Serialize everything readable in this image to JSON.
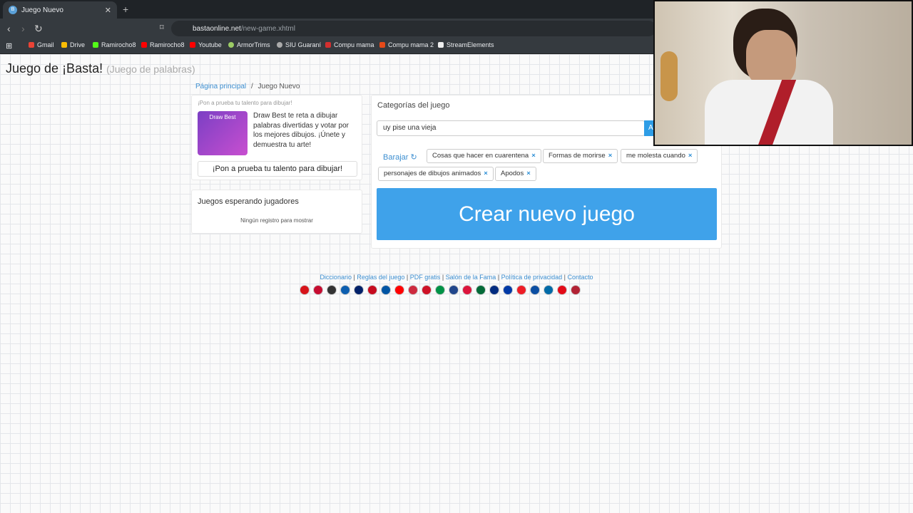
{
  "browser": {
    "tab_title": "Juego Nuevo",
    "url_domain": "bastaonline.net",
    "url_path": "/new-game.xhtml",
    "bookmarks": [
      "Gmail",
      "Drive",
      "Ramirocho8",
      "Ramirocho8",
      "Youtube",
      "ArmorTrims",
      "SIU Guaraní",
      "Compu mama",
      "Compu mama 2",
      "StreamElements"
    ]
  },
  "header": {
    "title": "Juego de ¡Basta!",
    "subtitle": "(Juego de palabras)"
  },
  "breadcrumb": {
    "home": "Página principal",
    "sep": "/",
    "current": "Juego Nuevo"
  },
  "promo": {
    "heading": "¡Pon a prueba tu talento para dibujar!",
    "image_label": "Draw Best",
    "text": "Draw Best te reta a dibujar palabras divertidas y votar por los mejores dibujos. ¡Únete y demuestra tu arte!",
    "button": "¡Pon a prueba tu talento para dibujar!"
  },
  "waiting": {
    "title": "Juegos esperando jugadores",
    "empty": "Ningún registro para mostrar"
  },
  "categories": {
    "title": "Categorías del juego",
    "input_value": "uy pise una vieja",
    "add_label": "A",
    "shuffle": "Barajar ↻",
    "tags": [
      "Cosas que hacer en cuarentena",
      "Formas de morirse",
      "me molesta cuando",
      "personajes de dibujos animados",
      "Apodos"
    ],
    "remove_symbol": "×",
    "create_button": "Crear nuevo juego"
  },
  "footer": {
    "links": [
      "Diccionario",
      "Reglas del juego",
      "PDF gratis",
      "Salón de la Fama",
      "Política de privacidad",
      "Contacto"
    ],
    "separator": "|",
    "flag_colors": [
      "#d7141a",
      "#c60c30",
      "#333333",
      "#0d5eaf",
      "#012169",
      "#c60b1e",
      "#0055a4",
      "#ff0000",
      "#cd2a3e",
      "#ce1126",
      "#009246",
      "#21468b",
      "#dc143c",
      "#046a38",
      "#002b7f",
      "#0039a6",
      "#ee1c25",
      "#0b4ea2",
      "#006aa7",
      "#e30a17",
      "#b22234"
    ]
  }
}
